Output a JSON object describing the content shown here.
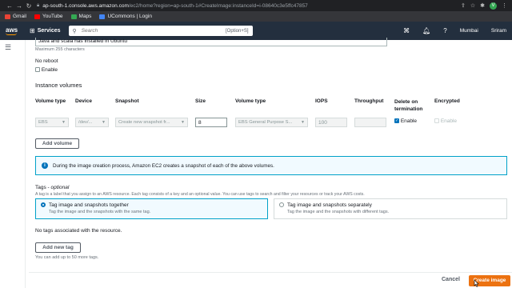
{
  "browser": {
    "url_host": "ap-south-1.console.aws.amazon.com",
    "url_path": "/ec2/home?region=ap-south-1#CreateImage:instanceId=i-08640c3e5ffc47857",
    "profile_initial": "V",
    "bookmarks": [
      {
        "label": "Gmail",
        "color": "#ea4335"
      },
      {
        "label": "YouTube",
        "color": "#ff0000"
      },
      {
        "label": "Maps",
        "color": "#34a853"
      },
      {
        "label": "UCommons | Login",
        "color": "#4285f4"
      }
    ]
  },
  "aws_nav": {
    "logo": "aws",
    "services_label": "Services",
    "search_placeholder": "Search",
    "search_shortcut": "[Option+S]",
    "region": "Mumbai",
    "user": "Sriram"
  },
  "form": {
    "description_value": "Java and scala has installed in Ubuntu",
    "description_hint": "Maximum 255 characters",
    "no_reboot_label": "No reboot",
    "no_reboot_enable": "Enable",
    "volumes_heading": "Instance volumes",
    "columns": [
      "Volume type",
      "Device",
      "Snapshot",
      "Size",
      "Volume type",
      "IOPS",
      "Throughput",
      "Delete on termination",
      "Encrypted"
    ],
    "volume_row": {
      "volume_type": "EBS",
      "device": "/dev/...",
      "snapshot": "Create new snapshot fr...",
      "size": "8",
      "ebs_type": "EBS General Purpose S...",
      "iops": "100",
      "throughput": "",
      "delete_on_termination": "Enable",
      "encrypted": "Enable"
    },
    "add_volume": "Add volume",
    "info_message": "During the image creation process, Amazon EC2 creates a snapshot of each of the above volumes.",
    "tags_heading": "Tags",
    "tags_optional": "optional",
    "tags_desc": "A tag is a label that you assign to an AWS resource. Each tag consists of a key and an optional value. You can use tags to search and filter your resources or track your AWS costs.",
    "tag_option_1_title": "Tag image and snapshots together",
    "tag_option_1_desc": "Tag the image and the snapshots with the same tag.",
    "tag_option_2_title": "Tag image and snapshots separately",
    "tag_option_2_desc": "Tag the image and the snapshots with different tags.",
    "no_tags": "No tags associated with the resource.",
    "add_tag": "Add new tag",
    "tag_limit": "You can add up to 50 more tags."
  },
  "footer": {
    "cancel": "Cancel",
    "create": "Create image"
  }
}
